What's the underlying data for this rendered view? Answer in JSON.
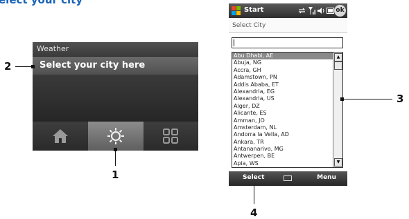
{
  "heading": "elect your city",
  "weather": {
    "header_title": "Weather",
    "city_prompt": "Select your city here",
    "tabs": [
      {
        "icon": "home-icon"
      },
      {
        "icon": "sun-icon",
        "active": true
      },
      {
        "icon": "grid-icon"
      }
    ]
  },
  "callouts": {
    "c1": "1",
    "c2": "2",
    "c3": "3",
    "c4": "4"
  },
  "phone": {
    "taskbar": {
      "start": "Start",
      "ok": "ok"
    },
    "title": "Select City",
    "input_value": "",
    "cities": [
      "Abu Dhabi, AE",
      "Abuja, NG",
      "Accra, GH",
      "Adamstown, PN",
      "Addis Ababa, ET",
      "Alexandria, EG",
      "Alexandria, US",
      "Alger, DZ",
      "Alicante, ES",
      "Amman, JO",
      "Amsterdam, NL",
      "Andorra la Vella, AD",
      "Ankara, TR",
      "Antananarivo, MG",
      "Antwerpen, BE",
      "Apia, WS"
    ],
    "selected_index": 0,
    "softkeys": {
      "left": "Select",
      "right": "Menu"
    }
  }
}
